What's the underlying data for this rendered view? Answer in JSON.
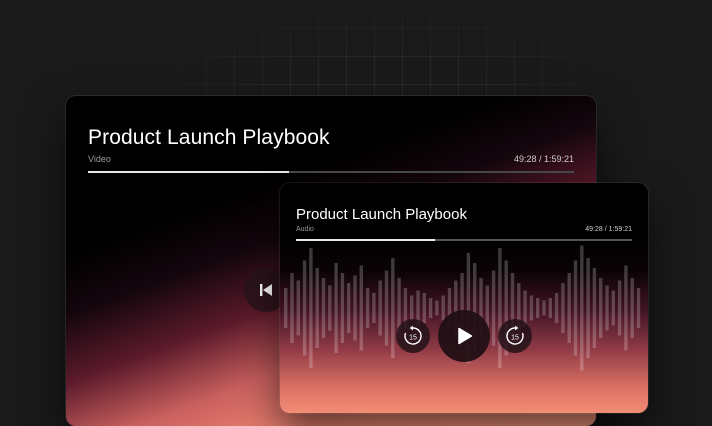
{
  "video_player": {
    "title": "Product Launch Playbook",
    "type_label": "Video",
    "time": "49:28 / 1:59:21",
    "progress": 0.4145,
    "controls": {
      "previous_icon": "skip-previous-icon"
    }
  },
  "audio_player": {
    "title": "Product Launch Playbook",
    "type_label": "Audio",
    "time": "49:28 / 1:59:21",
    "progress": 0.4145,
    "controls": {
      "rewind_icon": "rewind-15-icon",
      "rewind_seconds": "15",
      "play_icon": "play-icon",
      "forward_icon": "forward-15-icon",
      "forward_seconds": "15"
    }
  },
  "colors": {
    "page_background": "#1a1a1a",
    "accent_gradient_end": "#f79b7f",
    "progress_fill": "#e8e8e8"
  }
}
